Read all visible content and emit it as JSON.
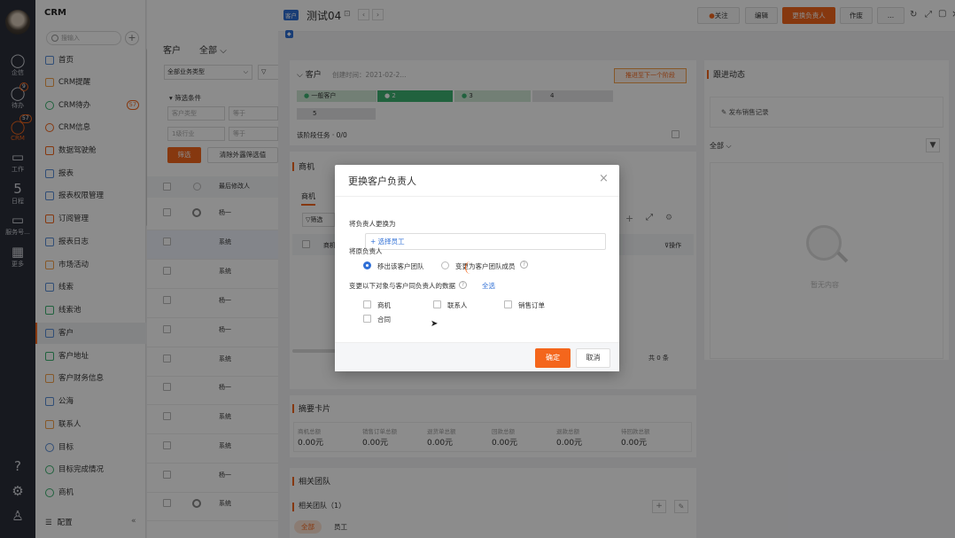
{
  "rail": {
    "items": [
      {
        "label": "企信",
        "icon": "chat-icon"
      },
      {
        "label": "待办",
        "icon": "todo-icon",
        "badge": "9"
      },
      {
        "label": "CRM",
        "icon": "crm-icon",
        "badge": "57"
      },
      {
        "label": "工作",
        "icon": "work-icon"
      },
      {
        "label": "日程",
        "icon": "calendar-icon",
        "day": "5"
      },
      {
        "label": "服务号...",
        "icon": "service-icon"
      },
      {
        "label": "更多",
        "icon": "more-icon"
      }
    ]
  },
  "sidebar": {
    "title": "CRM",
    "search_placeholder": "搜输入",
    "items": [
      {
        "label": "首页"
      },
      {
        "label": "CRM提醒"
      },
      {
        "label": "CRM待办",
        "count": "57"
      },
      {
        "label": "CRM信息"
      },
      {
        "label": "数据驾驶舱"
      },
      {
        "label": "报表"
      },
      {
        "label": "报表权限管理"
      },
      {
        "label": "订阅管理"
      },
      {
        "label": "报表日志"
      },
      {
        "label": "市场活动"
      },
      {
        "label": "线索"
      },
      {
        "label": "线索池"
      },
      {
        "label": "客户"
      },
      {
        "label": "客户地址"
      },
      {
        "label": "客户财务信息"
      },
      {
        "label": "公海"
      },
      {
        "label": "联系人"
      },
      {
        "label": "目标"
      },
      {
        "label": "目标完成情况"
      },
      {
        "label": "商机"
      }
    ],
    "config_label": "配置"
  },
  "list": {
    "title": "客户",
    "scope": "全部",
    "type_select": "全部业务类型",
    "filter_header": "筛选条件",
    "filter1_field": "客户类型",
    "filter1_op": "等于",
    "filter2_field": "1级行业",
    "filter2_op": "等于",
    "filter_button": "筛选",
    "clear_button": "清除外露筛选值",
    "col_modifier": "最后修改人",
    "rows": [
      "杨一",
      "系统",
      "系统",
      "杨一",
      "杨一",
      "系统",
      "杨一",
      "系统",
      "系统",
      "杨一",
      "系统",
      "杨一"
    ]
  },
  "detail": {
    "type_tag": "客户",
    "name": "测试04",
    "actions": {
      "follow": "关注",
      "edit": "编辑",
      "change_owner": "更换负责人",
      "void": "作废",
      "more": "..."
    },
    "customer_label": "客户",
    "created_time": "创建时间：2021-02-2...",
    "next_stage": "推进至下一个阶段",
    "stages": [
      "一般客户",
      "2",
      "3",
      "4",
      "5"
    ],
    "stage_tasks": "该阶段任务 · 0/0",
    "opportunity_title": "商机",
    "opportunity_tab": "商机",
    "opportunity_filter": "筛选",
    "col_name": "商机",
    "col_actions": "操作",
    "total": "共 0 条",
    "summary_title": "摘要卡片",
    "summary": [
      {
        "label": "商机总额",
        "value": "0.00元"
      },
      {
        "label": "销售订单总额",
        "value": "0.00元"
      },
      {
        "label": "退货单总额",
        "value": "0.00元"
      },
      {
        "label": "回款总额",
        "value": "0.00元"
      },
      {
        "label": "退款总额",
        "value": "0.00元"
      },
      {
        "label": "待回款总额",
        "value": "0.00元"
      }
    ],
    "team_title": "相关团队",
    "team_sub": "相关团队（1）",
    "team_tab_all": "全部",
    "team_tab_staff": "员工"
  },
  "follow": {
    "title": "跟进动态",
    "post": "发布销售记录",
    "scope": "全部",
    "empty": "暂无内容"
  },
  "modal": {
    "title": "更换客户负责人",
    "change_to_label": "将负责人更换为",
    "select_placeholder": "+ 选择员工",
    "original_label": "将原负责人",
    "opt_remove": "移出该客户团队",
    "opt_member": "变更为客户团队成员",
    "data_label": "变更以下对象与客户同负责人的数据",
    "select_all": "全选",
    "objects": [
      "商机",
      "联系人",
      "销售订单",
      "合同"
    ],
    "confirm": "确定",
    "cancel": "取消"
  },
  "colors": {
    "accent": "#f4661c",
    "blue": "#2f6fd6",
    "green": "#3cb371"
  }
}
